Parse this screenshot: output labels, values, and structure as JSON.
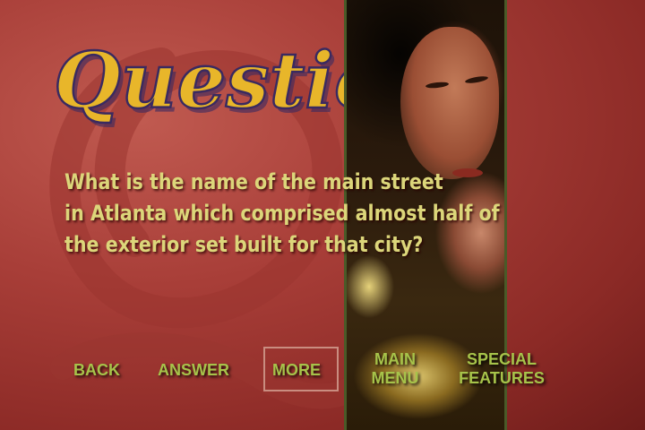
{
  "menu_title": "Question",
  "question_lines": [
    "What is the name of the main street",
    "in Atlanta which comprised almost half of",
    "the exterior set built for that city?"
  ],
  "buttons": {
    "back": "BACK",
    "answer": "ANSWER",
    "more": "MORE",
    "main_menu": [
      "MAIN",
      "MENU"
    ],
    "special_features": [
      "SPECIAL",
      "FEATURES"
    ]
  },
  "selected_button": "more",
  "colors": {
    "background": "#a83e38",
    "title_gold": "#e8b62a",
    "title_outline": "#3a2a60",
    "question_text": "#dcd67a",
    "button_text": "#a6c34a",
    "selection_frame": "#c98d80",
    "panel_border": "#4a5a28"
  }
}
